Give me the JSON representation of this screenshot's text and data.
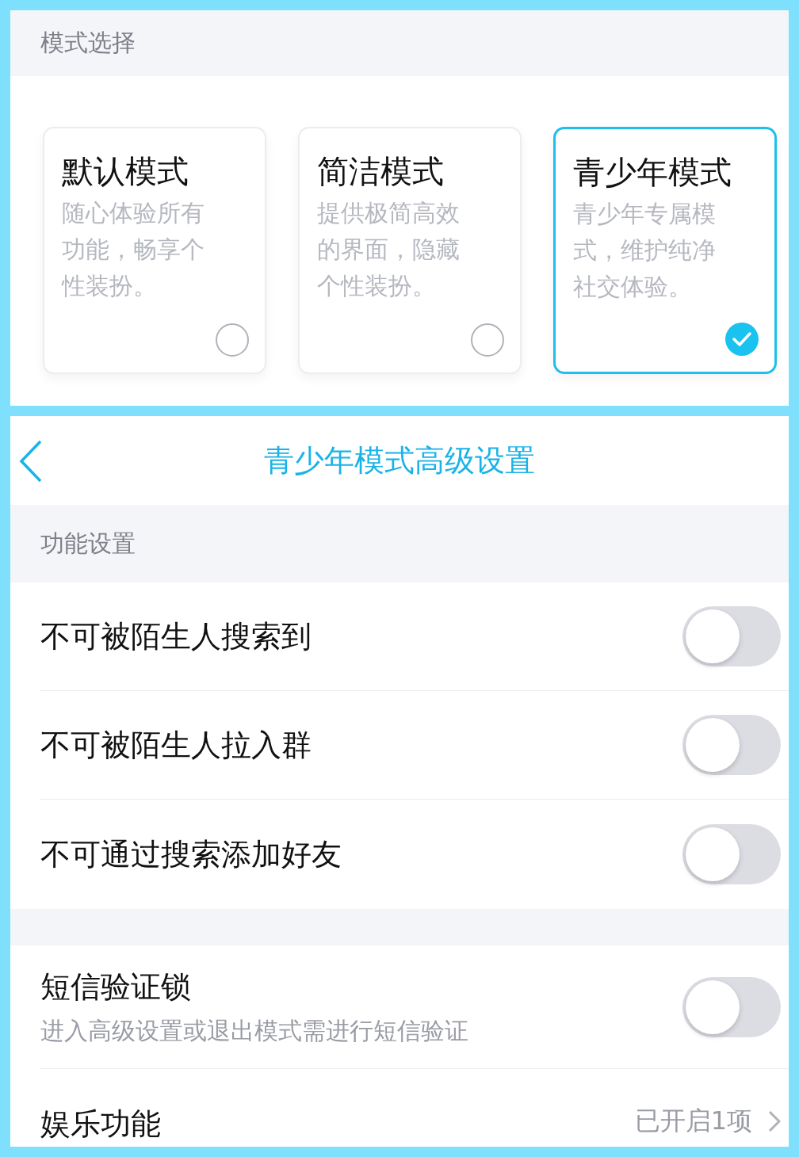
{
  "mode_section": {
    "title": "模式选择",
    "modes": [
      {
        "title": "默认模式",
        "description": "随心体验所有功能，畅享个性装扮。",
        "selected": false
      },
      {
        "title": "简洁模式",
        "description": "提供极简高效的界面，隐藏个性装扮。",
        "selected": false
      },
      {
        "title": "青少年模式",
        "description": "青少年专属模式，维护纯净社交体验。",
        "selected": true
      }
    ]
  },
  "settings_page": {
    "title": "青少年模式高级设置",
    "section_title": "功能设置",
    "toggles": [
      {
        "label": "不可被陌生人搜索到",
        "on": false
      },
      {
        "label": "不可被陌生人拉入群",
        "on": false
      },
      {
        "label": "不可通过搜索添加好友",
        "on": false
      }
    ],
    "sms_lock": {
      "label": "短信验证锁",
      "description": "进入高级设置或退出模式需进行短信验证",
      "on": false
    },
    "entertainment": {
      "label": "娱乐功能",
      "value": "已开启1项"
    }
  }
}
